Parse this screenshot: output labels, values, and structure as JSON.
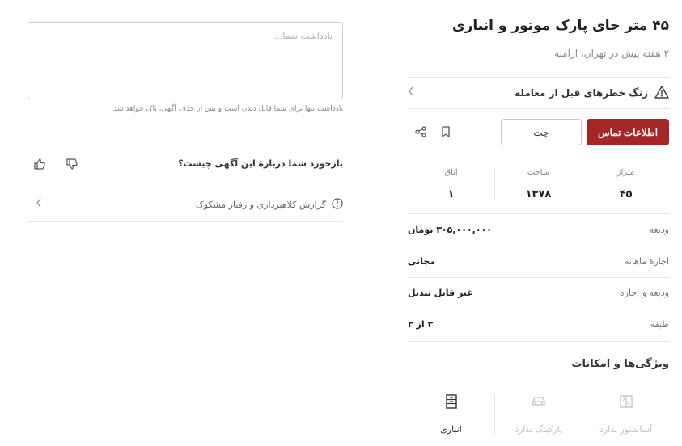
{
  "listing": {
    "title": "۴۵ متر جای پارک موتور و انباری",
    "subtitle": "۲ هفته پیش در تهران، ارامنه"
  },
  "warning": {
    "label": "زنگ خطرهای قبل از معامله"
  },
  "actions": {
    "contact_label": "اطلاعات تماس",
    "chat_label": "چت"
  },
  "stats": [
    {
      "key": "متراژ",
      "value": "۴۵"
    },
    {
      "key": "ساخت",
      "value": "۱۳۷۸"
    },
    {
      "key": "اتاق",
      "value": "۱"
    }
  ],
  "details": [
    {
      "key": "ودیعه",
      "value": "۳۰۵,۰۰۰,۰۰۰ تومان"
    },
    {
      "key": "اجارهٔ ماهانه",
      "value": "مجانی"
    },
    {
      "key": "ودیعه و اجاره",
      "value": "غیر قابل تبدیل"
    },
    {
      "key": "طبقه",
      "value": "۳ از ۳"
    }
  ],
  "features": {
    "title": "ویژگی‌ها و امکانات",
    "items": [
      {
        "label": "آسانسور ندارد",
        "icon": "elevator-icon",
        "active": false
      },
      {
        "label": "پارکینگ ندارد",
        "icon": "car-icon",
        "active": false
      },
      {
        "label": "انباری",
        "icon": "storage-icon",
        "active": true
      }
    ]
  },
  "note": {
    "placeholder": "یادداشت شما...",
    "hint": "یادداشت تنها برای شما قابل دیدن است و پس از حذف آگهی، پاک خواهد شد."
  },
  "feedback": {
    "question": "بازخورد شما دربارهٔ این آگهی چیست؟"
  },
  "report": {
    "label": "گزارش کلاهبرداری و رفتار مشکوک"
  },
  "colors": {
    "brand": "#a62626",
    "border": "#e6e6e6",
    "muted": "#8a8a8a"
  }
}
